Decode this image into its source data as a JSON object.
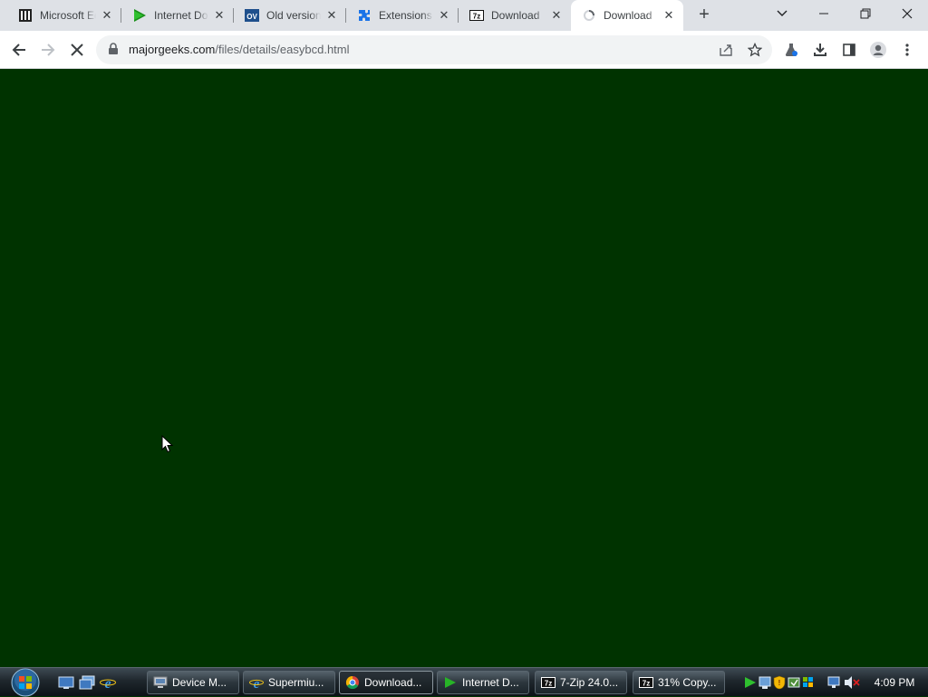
{
  "browser": {
    "tabs": [
      {
        "title": "Microsoft Edge",
        "icon": "microsoft-tab-icon",
        "active": false
      },
      {
        "title": "Internet Download Manager",
        "icon": "idm-tab-icon",
        "active": false
      },
      {
        "title": "Old version",
        "icon": "oldversion-tab-icon",
        "active": false
      },
      {
        "title": "Extensions",
        "icon": "extensions-tab-icon",
        "active": false
      },
      {
        "title": "Download",
        "icon": "7zip-tab-icon",
        "active": false
      },
      {
        "title": "Download",
        "icon": "loading-tab-icon",
        "active": true
      }
    ],
    "url_host": "majorgeeks.com",
    "url_path": "/files/details/easybcd.html"
  },
  "content": {
    "background_color": "#003300"
  },
  "taskbar": {
    "tasks": [
      {
        "label": "Device M...",
        "icon": "device-manager-icon",
        "active": false
      },
      {
        "label": "Supermiu...",
        "icon": "ie-icon",
        "active": false
      },
      {
        "label": "Download...",
        "icon": "chrome-icon",
        "active": true
      },
      {
        "label": "Internet D...",
        "icon": "idm-icon",
        "active": false
      },
      {
        "label": "7-Zip 24.0...",
        "icon": "7zip-icon",
        "active": false
      },
      {
        "label": "31% Copy...",
        "icon": "7zip-icon",
        "active": false
      }
    ],
    "clock": "4:09 PM"
  }
}
